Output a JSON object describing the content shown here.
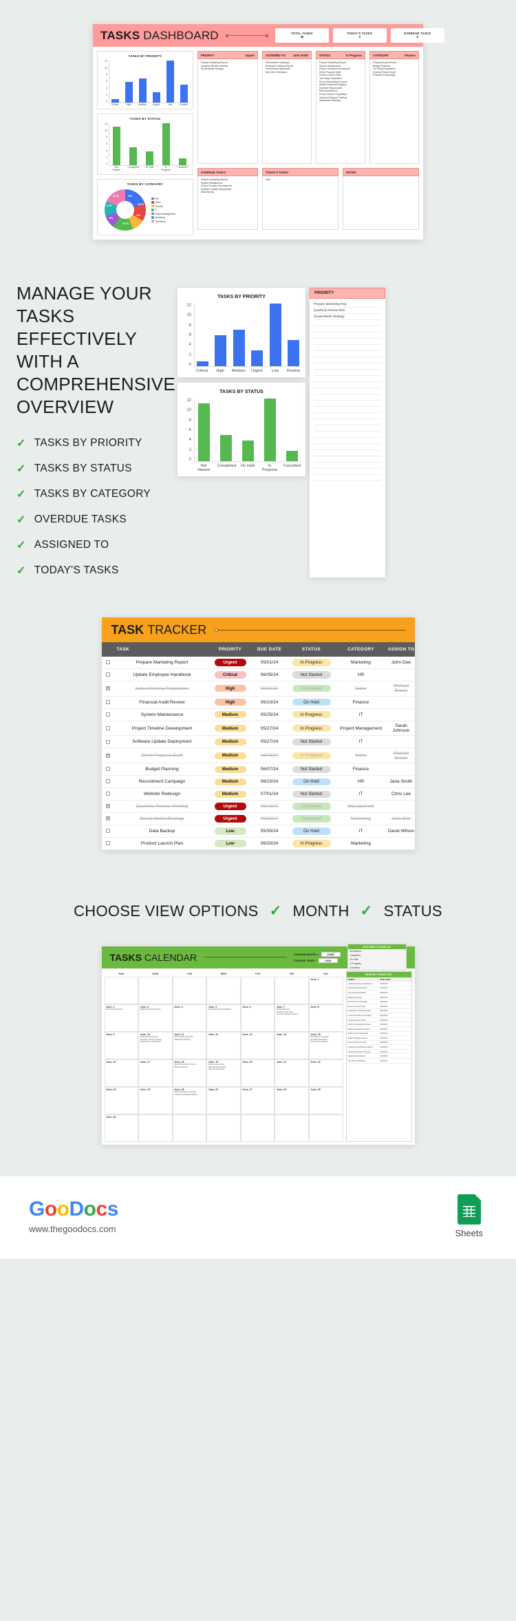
{
  "dashboard": {
    "title_bold": "TASKS",
    "title_light": "DASHBOARD",
    "stats": [
      {
        "label": "TOTAL TASKS",
        "value": "35"
      },
      {
        "label": "TODAY'S TASKS",
        "value": "0"
      },
      {
        "label": "OVERDUE TASKS",
        "value": "5"
      }
    ],
    "panels": {
      "priority_title": "TASKS BY PRIORITY",
      "status_title": "TASKS BY STATUS",
      "category_title": "TASKS BY CATEGORY",
      "priority_head_left": "PRIORITY",
      "priority_head_right": "Urgent",
      "assigned_head_left": "ASSIGNED TO",
      "assigned_head_right": "Jane Smith",
      "status_head_left": "STATUS",
      "status_head_right": "In Progress",
      "category_head_left": "CATEGORY",
      "category_head_right": "Finance",
      "overdue_head": "OVERDUE TASKS",
      "today_head": "TODAY'S TASKS",
      "notes_head": "NOTES"
    },
    "priority_list": [
      "Prepare Marketing Report",
      "Quarterly Review Meeting",
      "Social Media Strategy"
    ],
    "assigned_list": [
      "Recruitment Campaign",
      "Employee Training Manual",
      "Performance Appraisals",
      "New Hire Orientation"
    ],
    "status_list": [
      "Prepare Marketing Report",
      "System Maintenance",
      "Project Timeline Development",
      "Client Proposal Draft",
      "Product Launch Plan",
      "Tax Filing Preparation",
      "Client Onboarding Process",
      "Market Research Analysis",
      "Expense Report Audit",
      "Risk Assessment",
      "Product Demo Preparation",
      "Technical Support Training",
      "Stakeholder Meeting"
    ],
    "category_list": [
      "Financial Audit Review",
      "Budget Planning",
      "Tax Filing Preparation",
      "Expense Report Audit",
      "Financial Forecasting"
    ],
    "overdue_list": [
      "Prepare Marketing Report",
      "System Maintenance",
      "Project Timeline Development",
      "Software Update Deployment",
      "Data Backup"
    ],
    "today_list": [
      "mfvb"
    ],
    "notes_list": []
  },
  "chart_data": [
    {
      "type": "bar",
      "title": "TASKS BY PRIORITY",
      "categories": [
        "Critical",
        "High",
        "Medium",
        "Urgent",
        "Low",
        "Routine"
      ],
      "values": [
        1,
        6,
        7,
        3,
        12,
        5
      ],
      "xlabel": "",
      "ylabel": "",
      "ylim": [
        0,
        12
      ],
      "yticks": [
        0,
        2,
        4,
        6,
        8,
        10,
        12
      ],
      "color": "#3b72f0",
      "grid": false,
      "legend": "none"
    },
    {
      "type": "bar",
      "title": "TASKS BY STATUS",
      "categories": [
        "Not Started",
        "Completed",
        "On Hold",
        "In Progress",
        "Cancelled"
      ],
      "values": [
        11,
        5,
        4,
        12,
        2
      ],
      "xlabel": "",
      "ylabel": "",
      "ylim": [
        0,
        12
      ],
      "yticks": [
        0,
        2,
        4,
        6,
        8,
        10,
        12
      ],
      "color": "#55b94f",
      "grid": false,
      "legend": "none"
    },
    {
      "type": "pie",
      "title": "TASKS BY CATEGORY",
      "categories": [
        "HR",
        "Sales",
        "Finance",
        "IT",
        "Project Management",
        "Marketing",
        "Operations"
      ],
      "values": [
        20.0,
        13.9,
        10.0,
        16.1,
        10.0,
        11.9,
        18.1
      ],
      "labels": [
        "20%",
        "13.9%",
        "10%",
        "16.1%",
        "10%",
        "11.9%",
        "18.1%"
      ],
      "colors": [
        "#3b72f0",
        "#e8453c",
        "#f6b73c",
        "#55b94f",
        "#9c59d1",
        "#23b3b3",
        "#f07ab0"
      ],
      "legend": "right"
    }
  ],
  "promo": {
    "heading": "MANAGE YOUR TASKS EFFECTIVELY WITH A COMPREHENSIVE OVERVIEW",
    "features": [
      "TASKS BY PRIORITY",
      "TASKS BY STATUS",
      "TASKS BY CATEGORY",
      "OVERDUE TASKS",
      "ASSIGNED TO",
      "TODAY'S TASKS"
    ],
    "check_glyph": "✓",
    "side_panel_head": "PRIORITY",
    "side_panel_items": [
      "Prepare Marketing Rep",
      "Quarterly Review Mee",
      "Social Media Strategy"
    ]
  },
  "tracker": {
    "title_bold": "TASK",
    "title_light": "TRACKER",
    "columns": [
      "TASK",
      "PRIORITY",
      "DUE DATE",
      "STATUS",
      "CATEGORY",
      "ASSIGN TO"
    ],
    "rows": [
      {
        "checked": false,
        "task": "Prepare Marketing Report",
        "priority": "Urgent",
        "due": "05/01/24",
        "status": "In Progress",
        "category": "Marketing",
        "assign": "John Doe"
      },
      {
        "checked": false,
        "task": "Update Employee Handbook",
        "priority": "Critical",
        "due": "06/05/24",
        "status": "Not Started",
        "category": "HR",
        "assign": ""
      },
      {
        "checked": true,
        "task": "Sales Meeting Preparation",
        "priority": "High",
        "due": "05/30/24",
        "status": "Completed",
        "category": "Sales",
        "assign": "Michael Brown"
      },
      {
        "checked": false,
        "task": "Financial Audit Review",
        "priority": "High",
        "due": "06/10/24",
        "status": "On Hold",
        "category": "Finance",
        "assign": ""
      },
      {
        "checked": false,
        "task": "System Maintenance",
        "priority": "Medium",
        "due": "05/25/24",
        "status": "In Progress",
        "category": "IT",
        "assign": ""
      },
      {
        "checked": false,
        "task": "Project Timeline Development",
        "priority": "Medium",
        "due": "05/27/24",
        "status": "In Progress",
        "category": "Project Management",
        "assign": "Sarah Johnson"
      },
      {
        "checked": false,
        "task": "Software Update Deployment",
        "priority": "Medium",
        "due": "05/27/24",
        "status": "Not Started",
        "category": "IT",
        "assign": ""
      },
      {
        "checked": true,
        "task": "Client Proposal Draft",
        "priority": "Medium",
        "due": "06/02/24",
        "status": "In Progress",
        "category": "Sales",
        "assign": "Michael Brown"
      },
      {
        "checked": false,
        "task": "Budget Planning",
        "priority": "Medium",
        "due": "06/07/24",
        "status": "Not Started",
        "category": "Finance",
        "assign": ""
      },
      {
        "checked": false,
        "task": "Recruitment Campaign",
        "priority": "Medium",
        "due": "06/15/24",
        "status": "On Hold",
        "category": "HR",
        "assign": "Jane Smith"
      },
      {
        "checked": false,
        "task": "Website Redesign",
        "priority": "Medium",
        "due": "07/01/24",
        "status": "Not Started",
        "category": "IT",
        "assign": "Chris Lee"
      },
      {
        "checked": true,
        "task": "Quarterly Review Meeting",
        "priority": "Urgent",
        "due": "06/02/24",
        "status": "Completed",
        "category": "Management",
        "assign": ""
      },
      {
        "checked": true,
        "task": "Social Media Strategy",
        "priority": "Urgent",
        "due": "06/02/24",
        "status": "Completed",
        "category": "Marketing",
        "assign": "John Doe"
      },
      {
        "checked": false,
        "task": "Data Backup",
        "priority": "Low",
        "due": "05/30/24",
        "status": "On Hold",
        "category": "IT",
        "assign": "David Wilson"
      },
      {
        "checked": false,
        "task": "Product Launch Plan",
        "priority": "Low",
        "due": "06/20/24",
        "status": "In Progress",
        "category": "Marketing",
        "assign": ""
      }
    ]
  },
  "view_options": {
    "label": "CHOOSE VIEW OPTIONS",
    "check_glyph": "✓",
    "option_month": "MONTH",
    "option_status": "STATUS"
  },
  "calendar": {
    "title_bold": "TASKS",
    "title_light": "CALENDAR",
    "choose_month_label": "CHOOSE MONTH  >",
    "choose_year_label": "CHOOSE YEAR  >",
    "month_value": "JUNE",
    "year_value": "2024",
    "statuses_title": "STATUSES TO DISPLAY",
    "statuses": [
      "Not Started",
      "Completed",
      "On Hold",
      "In Progress",
      "Cancelled"
    ],
    "side_title": "MONTHLY TASKS LIST",
    "side_columns": [
      "TASKS",
      "DUE DATE"
    ],
    "side_rows": [
      {
        "task": "Update Employee Handbook",
        "due": "06/05/24"
      },
      {
        "task": "Financial Audit Review",
        "due": "06/10/24"
      },
      {
        "task": "Client Proposal Draft",
        "due": "06/02/24"
      },
      {
        "task": "Budget Planning",
        "due": "06/07/24"
      },
      {
        "task": "Recruitment Campaign",
        "due": "06/15/24"
      },
      {
        "task": "Product Launch Plan",
        "due": "06/20/24"
      },
      {
        "task": "Employee Training Session",
        "due": "06/12/24"
      },
      {
        "task": "Lead Generation Campaign",
        "due": "06/15/24"
      },
      {
        "task": "Product Launch Plan",
        "due": "06/20/24"
      },
      {
        "task": "Client Onboarding Process",
        "due": "06/18/24"
      },
      {
        "task": "Market Research Analysis",
        "due": "06/25/24"
      },
      {
        "task": "Performance Appraisals",
        "due": "06/22/24"
      },
      {
        "task": "Sales Strategy Review",
        "due": "06/28/24"
      },
      {
        "task": "Expense Report Audit",
        "due": "06/30/24"
      },
      {
        "task": "Customer Feedback Analysis",
        "due": "06/26/24"
      },
      {
        "task": "Technical Support Training",
        "due": "06/24/24"
      },
      {
        "task": "Stakeholder Meeting",
        "due": "06/19/24"
      },
      {
        "task": "New Hire Orientation",
        "due": "06/11/24"
      }
    ],
    "dow": [
      "SUN",
      "MON",
      "TUE",
      "WED",
      "THU",
      "FRI",
      "SAT"
    ],
    "weeks": [
      [
        {
          "day": "",
          "events": []
        },
        {
          "day": "",
          "events": []
        },
        {
          "day": "",
          "events": []
        },
        {
          "day": "",
          "events": []
        },
        {
          "day": "",
          "events": []
        },
        {
          "day": "",
          "events": []
        },
        {
          "day": "June, 1",
          "events": []
        }
      ],
      [
        {
          "day": "June, 2",
          "events": [
            "Client Proposal Draft"
          ]
        },
        {
          "day": "June, 3",
          "events": [
            "Market Research Analysis"
          ]
        },
        {
          "day": "June, 4",
          "events": []
        },
        {
          "day": "June, 5",
          "events": [
            "Update Employee Handbook"
          ]
        },
        {
          "day": "June, 6",
          "events": []
        },
        {
          "day": "June, 7",
          "events": [
            "Budget Planning",
            "Product Launch Plan",
            "Technical Support Training"
          ]
        },
        {
          "day": "June, 8",
          "events": []
        }
      ],
      [
        {
          "day": "June, 9",
          "events": []
        },
        {
          "day": "June, 10",
          "events": [
            "Financial Audit Review",
            "Employee Training Session",
            "Product Demo Preparation"
          ]
        },
        {
          "day": "June, 11",
          "events": [
            "Performance Appraisals",
            "Stakeholder Meeting"
          ]
        },
        {
          "day": "June, 12",
          "events": []
        },
        {
          "day": "June, 13",
          "events": []
        },
        {
          "day": "June, 14",
          "events": []
        },
        {
          "day": "June, 15",
          "events": [
            "Recruitment Campaign",
            "Tax Filing Preparation",
            "Financial Forecasting"
          ]
        }
      ],
      [
        {
          "day": "June, 16",
          "events": []
        },
        {
          "day": "June, 17",
          "events": []
        },
        {
          "day": "June, 18",
          "events": [
            "Client Onboarding Process",
            "Risk Assessment"
          ]
        },
        {
          "day": "June, 19",
          "events": [
            "Product Launch Plan",
            "Sales Strategy Review",
            "New Hire Orientation"
          ]
        },
        {
          "day": "June, 20",
          "events": []
        },
        {
          "day": "June, 21",
          "events": []
        },
        {
          "day": "June, 22",
          "events": []
        }
      ],
      [
        {
          "day": "June, 23",
          "events": []
        },
        {
          "day": "June, 24",
          "events": []
        },
        {
          "day": "June, 25",
          "events": [
            "Lead Generation Campaign",
            "Customer Feedback Analysis"
          ]
        },
        {
          "day": "June, 26",
          "events": []
        },
        {
          "day": "June, 27",
          "events": []
        },
        {
          "day": "June, 28",
          "events": []
        },
        {
          "day": "June, 29",
          "events": []
        }
      ],
      [
        {
          "day": "June, 30",
          "events": []
        },
        {
          "day": "",
          "events": []
        },
        {
          "day": "",
          "events": []
        },
        {
          "day": "",
          "events": []
        },
        {
          "day": "",
          "events": []
        },
        {
          "day": "",
          "events": []
        },
        {
          "day": "",
          "events": []
        }
      ]
    ]
  },
  "footer": {
    "logo_letters": [
      "G",
      "o",
      "o",
      "D",
      "o",
      "c",
      "s"
    ],
    "url": "www.thegoodocs.com",
    "product": "Sheets"
  }
}
